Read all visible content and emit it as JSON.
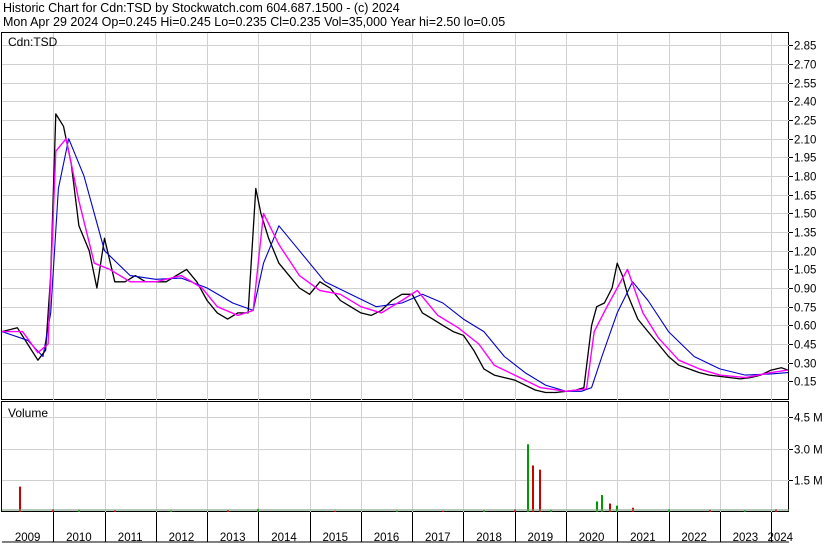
{
  "header": {
    "line1": "Historic Chart for Cdn:TSD by Stockwatch.com 604.687.1500 - (c) 2024",
    "line2": "Mon Apr 29 2024   Op=0.245   Hi=0.245   Lo=0.235   Cl=0.235   Vol=35,000   Year hi=2.50   lo=0.05"
  },
  "chart_data": [
    {
      "type": "line",
      "title": "Cdn:TSD",
      "ylim": [
        0.0,
        2.95
      ],
      "y_ticks": [
        "2.85",
        "2.70",
        "2.55",
        "2.40",
        "2.25",
        "2.10",
        "1.95",
        "1.80",
        "1.65",
        "1.50",
        "1.35",
        "1.20",
        "1.05",
        "0.90",
        "0.75",
        "0.60",
        "0.45",
        "0.30",
        "0.15"
      ],
      "x_ticks": [
        "2009",
        "2010",
        "2011",
        "2012",
        "2013",
        "2014",
        "2015",
        "2016",
        "2017",
        "2018",
        "2019",
        "2020",
        "2021",
        "2022",
        "2023",
        "2024"
      ],
      "series": [
        {
          "role": "price",
          "color": "#000000",
          "x": [
            2009.0,
            2009.3,
            2009.5,
            2009.7,
            2009.85,
            2009.95,
            2010.05,
            2010.2,
            2010.35,
            2010.5,
            2010.7,
            2010.85,
            2011.0,
            2011.2,
            2011.4,
            2011.6,
            2011.8,
            2012.0,
            2012.2,
            2012.4,
            2012.6,
            2012.8,
            2013.0,
            2013.2,
            2013.4,
            2013.6,
            2013.8,
            2013.95,
            2014.05,
            2014.2,
            2014.4,
            2014.6,
            2014.8,
            2015.0,
            2015.2,
            2015.4,
            2015.6,
            2015.8,
            2016.0,
            2016.2,
            2016.4,
            2016.6,
            2016.8,
            2017.0,
            2017.2,
            2017.4,
            2017.6,
            2017.8,
            2018.0,
            2018.2,
            2018.4,
            2018.6,
            2018.8,
            2019.0,
            2019.2,
            2019.4,
            2019.6,
            2019.8,
            2020.0,
            2020.2,
            2020.35,
            2020.5,
            2020.6,
            2020.75,
            2020.9,
            2021.0,
            2021.1,
            2021.2,
            2021.4,
            2021.6,
            2021.8,
            2022.0,
            2022.2,
            2022.4,
            2022.6,
            2022.8,
            2023.0,
            2023.2,
            2023.4,
            2023.6,
            2023.8,
            2024.0,
            2024.2,
            2024.33
          ],
          "values": [
            0.55,
            0.58,
            0.45,
            0.32,
            0.4,
            1.0,
            2.3,
            2.2,
            1.9,
            1.4,
            1.2,
            0.9,
            1.3,
            0.95,
            0.95,
            1.0,
            0.95,
            0.95,
            0.95,
            1.0,
            1.05,
            0.95,
            0.8,
            0.7,
            0.65,
            0.7,
            0.7,
            1.7,
            1.5,
            1.3,
            1.1,
            1.0,
            0.9,
            0.85,
            0.95,
            0.9,
            0.8,
            0.75,
            0.7,
            0.68,
            0.72,
            0.8,
            0.85,
            0.85,
            0.7,
            0.65,
            0.6,
            0.55,
            0.52,
            0.4,
            0.25,
            0.2,
            0.18,
            0.16,
            0.12,
            0.08,
            0.06,
            0.06,
            0.07,
            0.08,
            0.1,
            0.6,
            0.75,
            0.78,
            0.9,
            1.1,
            1.0,
            0.85,
            0.65,
            0.55,
            0.45,
            0.35,
            0.28,
            0.25,
            0.22,
            0.2,
            0.19,
            0.18,
            0.17,
            0.18,
            0.2,
            0.24,
            0.26,
            0.24
          ]
        },
        {
          "role": "short moving average",
          "color": "#ff00ff",
          "x": [
            2009.0,
            2009.4,
            2009.7,
            2009.9,
            2010.05,
            2010.25,
            2010.5,
            2010.8,
            2011.1,
            2011.5,
            2012.0,
            2012.5,
            2012.9,
            2013.2,
            2013.6,
            2013.9,
            2014.1,
            2014.4,
            2014.8,
            2015.2,
            2015.6,
            2016.0,
            2016.4,
            2016.8,
            2017.1,
            2017.5,
            2017.9,
            2018.3,
            2018.6,
            2019.0,
            2019.5,
            2020.0,
            2020.4,
            2020.55,
            2020.8,
            2021.0,
            2021.2,
            2021.5,
            2021.8,
            2022.2,
            2022.6,
            2023.0,
            2023.5,
            2024.0,
            2024.33
          ],
          "values": [
            0.55,
            0.55,
            0.38,
            0.45,
            2.0,
            2.1,
            1.6,
            1.1,
            1.05,
            0.95,
            0.95,
            1.0,
            0.9,
            0.75,
            0.68,
            0.72,
            1.5,
            1.25,
            1.0,
            0.88,
            0.85,
            0.75,
            0.7,
            0.8,
            0.88,
            0.68,
            0.58,
            0.45,
            0.28,
            0.2,
            0.1,
            0.07,
            0.09,
            0.55,
            0.75,
            0.9,
            1.05,
            0.7,
            0.5,
            0.32,
            0.25,
            0.2,
            0.18,
            0.22,
            0.24
          ]
        },
        {
          "role": "long moving average",
          "color": "#0000cc",
          "x": [
            2009.0,
            2009.5,
            2009.8,
            2009.95,
            2010.1,
            2010.3,
            2010.6,
            2011.0,
            2011.5,
            2012.0,
            2012.5,
            2013.0,
            2013.5,
            2013.9,
            2014.1,
            2014.4,
            2014.8,
            2015.3,
            2015.8,
            2016.3,
            2016.8,
            2017.2,
            2017.6,
            2018.0,
            2018.4,
            2018.8,
            2019.2,
            2019.6,
            2020.0,
            2020.3,
            2020.5,
            2020.7,
            2021.0,
            2021.3,
            2021.6,
            2022.0,
            2022.5,
            2023.0,
            2023.5,
            2024.0,
            2024.33
          ],
          "values": [
            0.55,
            0.48,
            0.35,
            0.7,
            1.7,
            2.1,
            1.8,
            1.2,
            1.0,
            0.97,
            0.98,
            0.9,
            0.78,
            0.72,
            1.1,
            1.4,
            1.2,
            0.95,
            0.85,
            0.75,
            0.78,
            0.85,
            0.78,
            0.65,
            0.55,
            0.35,
            0.22,
            0.12,
            0.07,
            0.07,
            0.1,
            0.35,
            0.7,
            0.95,
            0.8,
            0.55,
            0.35,
            0.25,
            0.2,
            0.21,
            0.22
          ]
        }
      ]
    },
    {
      "type": "bar",
      "title": "Volume",
      "ylim": [
        0,
        5200000
      ],
      "y_ticks": [
        "4.5 M",
        "3.0 M",
        "1.5 M"
      ],
      "series": [
        {
          "name": "",
          "bars": [
            {
              "x": 2009.35,
              "v": 1200000,
              "color": "#cc0000"
            },
            {
              "x": 2010.0,
              "v": 120000,
              "color": "#cc0000"
            },
            {
              "x": 2010.5,
              "v": 100000,
              "color": "#009900"
            },
            {
              "x": 2011.2,
              "v": 80000,
              "color": "#cc0000"
            },
            {
              "x": 2012.3,
              "v": 70000,
              "color": "#009900"
            },
            {
              "x": 2013.4,
              "v": 90000,
              "color": "#cc0000"
            },
            {
              "x": 2014.0,
              "v": 150000,
              "color": "#009900"
            },
            {
              "x": 2015.5,
              "v": 60000,
              "color": "#cc0000"
            },
            {
              "x": 2016.7,
              "v": 70000,
              "color": "#009900"
            },
            {
              "x": 2017.6,
              "v": 60000,
              "color": "#cc0000"
            },
            {
              "x": 2018.4,
              "v": 80000,
              "color": "#009900"
            },
            {
              "x": 2019.0,
              "v": 120000,
              "color": "#cc0000"
            },
            {
              "x": 2019.25,
              "v": 3200000,
              "color": "#009900"
            },
            {
              "x": 2019.35,
              "v": 2200000,
              "color": "#cc0000"
            },
            {
              "x": 2019.5,
              "v": 2000000,
              "color": "#cc0000"
            },
            {
              "x": 2019.7,
              "v": 100000,
              "color": "#009900"
            },
            {
              "x": 2020.6,
              "v": 500000,
              "color": "#009900"
            },
            {
              "x": 2020.7,
              "v": 800000,
              "color": "#009900"
            },
            {
              "x": 2020.85,
              "v": 400000,
              "color": "#cc0000"
            },
            {
              "x": 2021.0,
              "v": 300000,
              "color": "#009900"
            },
            {
              "x": 2021.3,
              "v": 200000,
              "color": "#cc0000"
            },
            {
              "x": 2022.0,
              "v": 120000,
              "color": "#009900"
            },
            {
              "x": 2022.8,
              "v": 100000,
              "color": "#cc0000"
            },
            {
              "x": 2023.5,
              "v": 80000,
              "color": "#009900"
            },
            {
              "x": 2024.1,
              "v": 120000,
              "color": "#cc0000"
            }
          ]
        }
      ]
    }
  ]
}
